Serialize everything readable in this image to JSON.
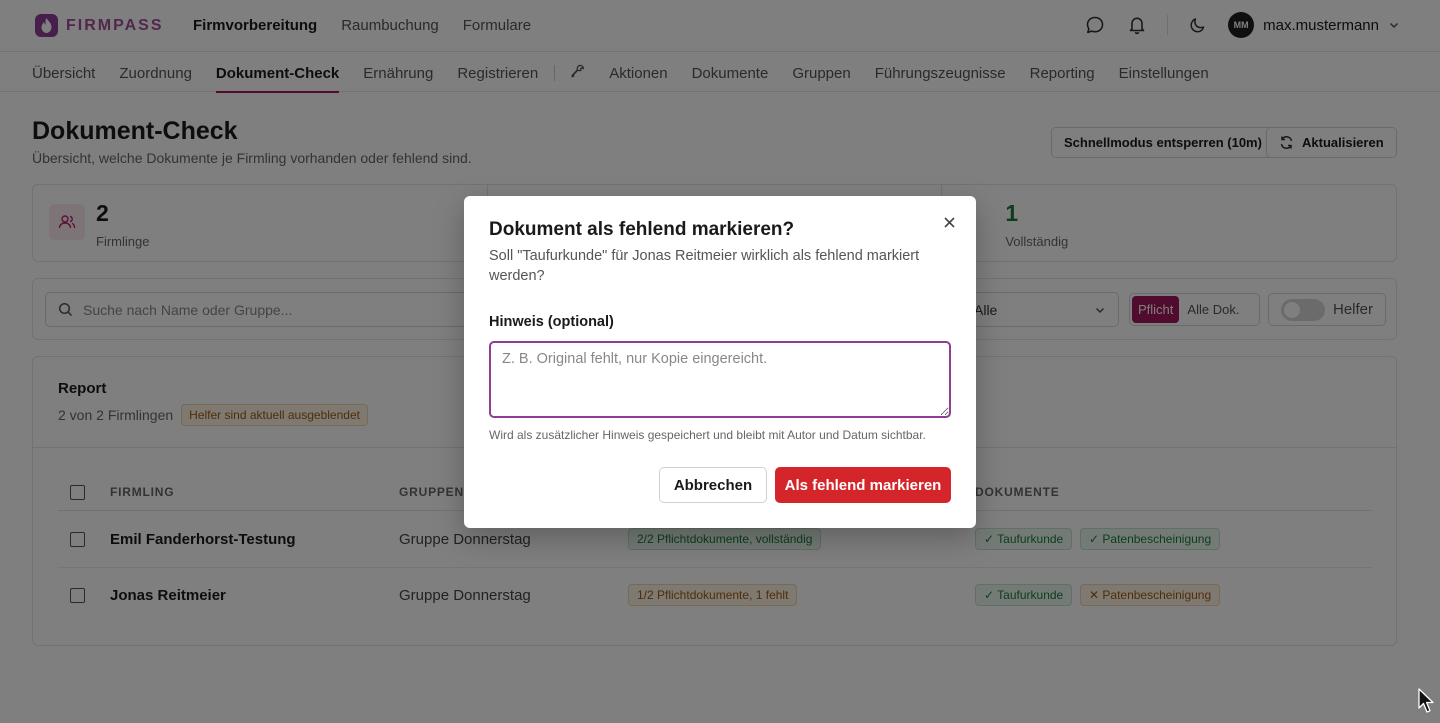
{
  "app": {
    "brand": "FIRMPASS",
    "main_nav": [
      "Firmvorbereitung",
      "Raumbuchung",
      "Formulare"
    ],
    "user": {
      "initials": "MM",
      "name": "max.mustermann"
    }
  },
  "subnav": {
    "items_left": [
      "Übersicht",
      "Zuordnung",
      "Dokument-Check",
      "Ernährung",
      "Registrieren"
    ],
    "items_right": [
      "Aktionen",
      "Dokumente",
      "Gruppen",
      "Führungszeugnisse",
      "Reporting",
      "Einstellungen"
    ]
  },
  "page": {
    "title": "Dokument-Check",
    "subtitle": "Übersicht, welche Dokumente je Firmling vorhanden oder fehlend sind.",
    "quickmode_button": "Schnellmodus entsperren (10m)",
    "refresh_button": "Aktualisieren"
  },
  "stats": [
    {
      "value": "2",
      "label": "Firmlinge"
    },
    {
      "value": "",
      "label": ""
    },
    {
      "value": "1",
      "label": "Vollständig"
    }
  ],
  "filters": {
    "search_placeholder": "Suche nach Name oder Gruppe...",
    "select_value": "Alle",
    "seg_on": "Pflicht",
    "seg_off": "Alle Dok.",
    "toggle_label": "Helfer"
  },
  "report": {
    "title": "Report",
    "count_text": "2 von 2 Firmlingen",
    "badge": "Helfer sind aktuell ausgeblendet",
    "columns": [
      "FIRMLING",
      "GRUPPEN",
      "DOKUMENTE"
    ],
    "rows": [
      {
        "name": "Emil Fanderhorst-Testung",
        "group": "Gruppe Donnerstag",
        "status": "2/2 Pflichtdokumente, vollständig",
        "doc1": "✓ Taufurkunde",
        "doc2": "✓ Patenbescheinigung"
      },
      {
        "name": "Jonas Reitmeier",
        "group": "Gruppe Donnerstag",
        "status": "1/2 Pflichtdokumente, 1 fehlt",
        "doc1": "✓ Taufurkunde",
        "doc2": "✕ Patenbescheinigung"
      }
    ]
  },
  "modal": {
    "title": "Dokument als fehlend markieren?",
    "description": "Soll \"Taufurkunde\" für Jonas Reitmeier wirklich als fehlend markiert werden?",
    "field_label": "Hinweis (optional)",
    "placeholder": "Z. B. Original fehlt, nur Kopie eingereicht.",
    "help": "Wird als zusätzlicher Hinweis gespeichert und bleibt mit Autor und Datum sichtbar.",
    "cancel": "Abbrechen",
    "confirm": "Als fehlend markieren"
  },
  "colors": {
    "brand": "#a3175d",
    "logo": "#8e3e97",
    "danger": "#d4262a"
  }
}
